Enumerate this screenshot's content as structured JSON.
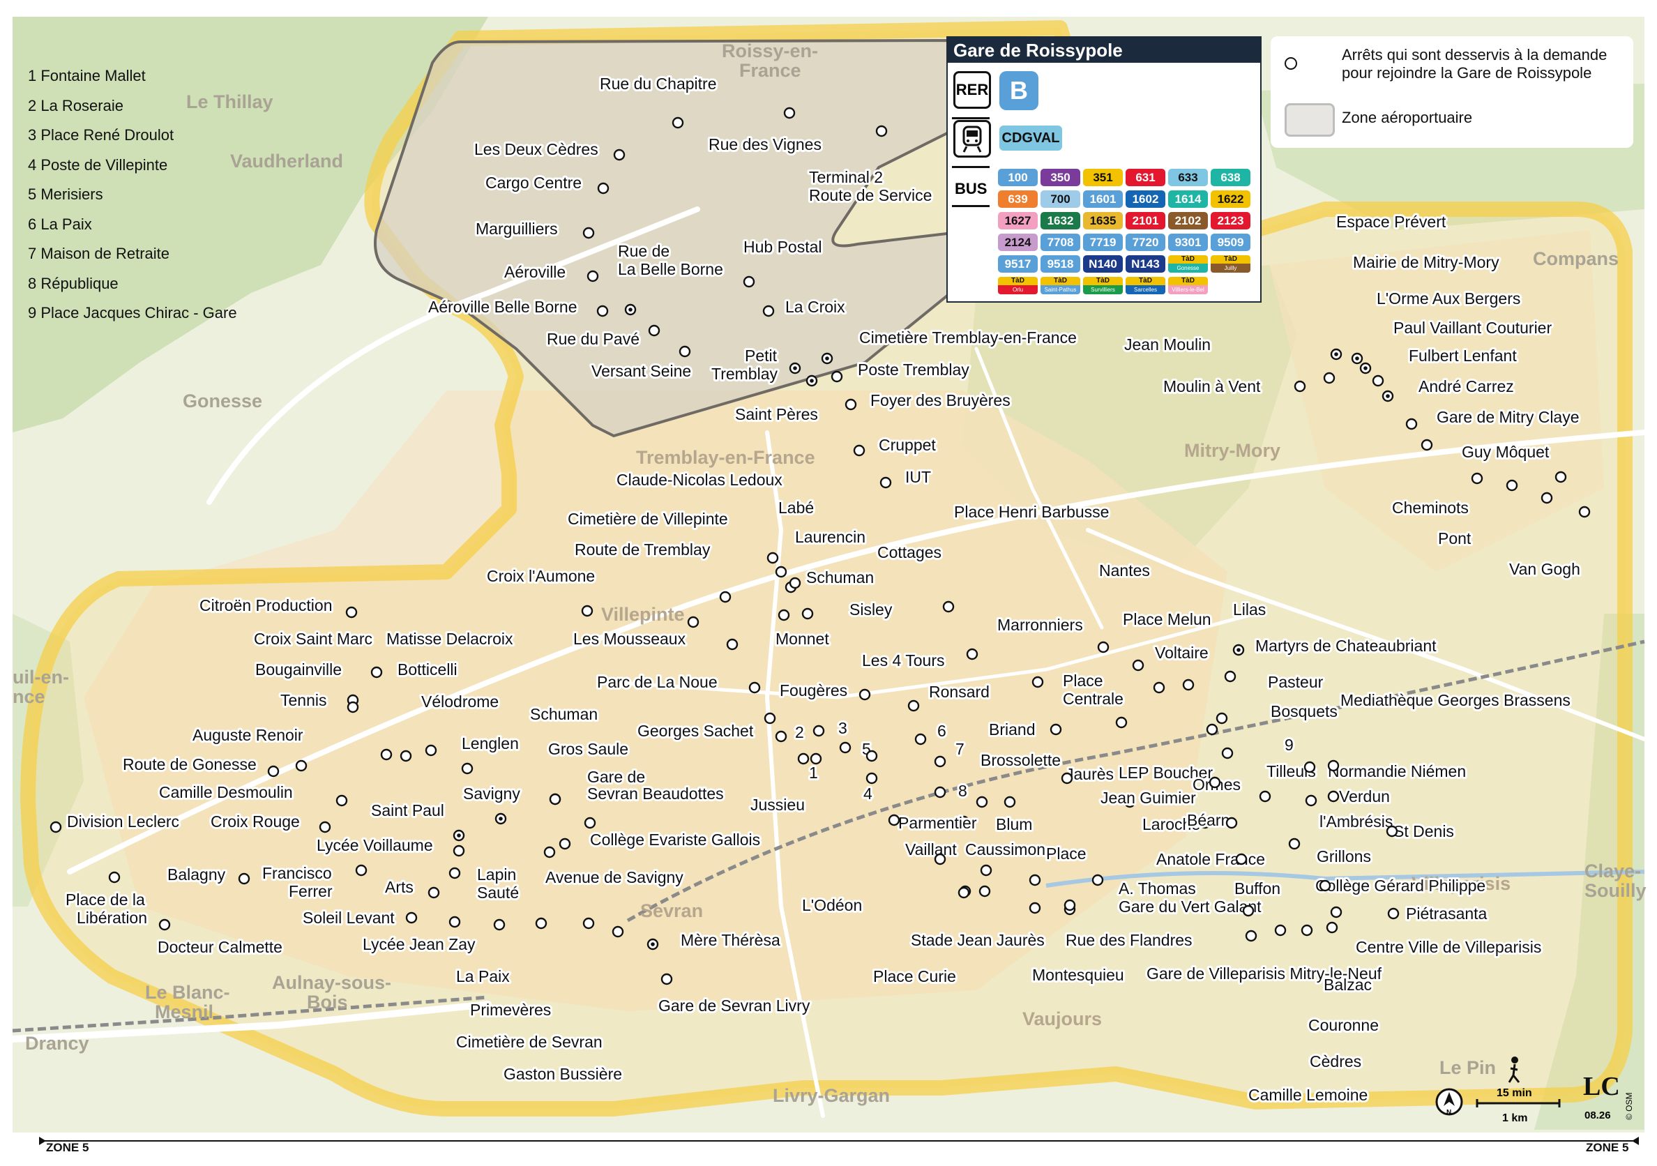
{
  "numbered_stops": [
    "1 Fontaine Mallet",
    "2 La Roseraie",
    "3 Place René Droulot",
    "4 Poste de Villepinte",
    "5 Merisiers",
    "6 La Paix",
    "7 Maison de Retraite",
    "8 République",
    "9 Place Jacques Chirac - Gare"
  ],
  "legend": {
    "on_demand_text": "Arrêts qui sont desservis à la demande\npour  rejoindre la Gare de Roissypole",
    "zone_text": "Zone aéroportuaire"
  },
  "gare": {
    "title": "Gare de Roissypole",
    "rer_label": "RER",
    "rer_line": "B",
    "cdgval_label": "CDGVAL",
    "bus_label": "BUS",
    "bus_lines": [
      {
        "n": "100",
        "c": "#5aa0d8"
      },
      {
        "n": "350",
        "c": "#7b3b9a"
      },
      {
        "n": "351",
        "c": "#f2c200",
        "t": "#111"
      },
      {
        "n": "631",
        "c": "#e3182e"
      },
      {
        "n": "633",
        "c": "#7fc6e2",
        "t": "#111"
      },
      {
        "n": "638",
        "c": "#1fb5a4"
      },
      {
        "n": "639",
        "c": "#ef7f2f"
      },
      {
        "n": "700",
        "c": "#9ecbe8",
        "t": "#111"
      },
      {
        "n": "1601",
        "c": "#5aa0d8"
      },
      {
        "n": "1602",
        "c": "#1565b5"
      },
      {
        "n": "1614",
        "c": "#1fb5a4"
      },
      {
        "n": "1622",
        "c": "#f2c200",
        "t": "#111"
      },
      {
        "n": "1627",
        "c": "#f29fc0",
        "t": "#111"
      },
      {
        "n": "1632",
        "c": "#1b7a4a"
      },
      {
        "n": "1635",
        "c": "#e8b830",
        "t": "#111"
      },
      {
        "n": "2101",
        "c": "#e3182e"
      },
      {
        "n": "2102",
        "c": "#8b5a2b"
      },
      {
        "n": "2123",
        "c": "#e3182e"
      },
      {
        "n": "2124",
        "c": "#c79ccc",
        "t": "#111"
      },
      {
        "n": "7708",
        "c": "#5aa0d8"
      },
      {
        "n": "7719",
        "c": "#5aa0d8"
      },
      {
        "n": "7720",
        "c": "#5aa0d8"
      },
      {
        "n": "9301",
        "c": "#5aa0d8"
      },
      {
        "n": "9509",
        "c": "#5aa0d8"
      },
      {
        "n": "9517",
        "c": "#5aa0d8"
      },
      {
        "n": "9518",
        "c": "#5aa0d8"
      },
      {
        "n": "N140",
        "c": "#1b3a8a"
      },
      {
        "n": "N143",
        "c": "#1b3a8a"
      }
    ],
    "tad_lines": [
      {
        "top": "TàD",
        "bot": "Gonesse",
        "c": "#1fb5a4"
      },
      {
        "top": "TàD",
        "bot": "Juilly",
        "c": "#8b5a2b"
      },
      {
        "top": "TàD",
        "bot": "Orlu",
        "c": "#e3182e"
      },
      {
        "top": "TàD",
        "bot": "Saint-Pathus",
        "c": "#5aa0d8"
      },
      {
        "top": "TàD",
        "bot": "Survilliers",
        "c": "#1b9a4a"
      },
      {
        "top": "TàD",
        "bot": "Sarcelles",
        "c": "#1565b5"
      },
      {
        "top": "TàD",
        "bot": "Villiers-le-Bel",
        "c": "#f29fc0"
      }
    ]
  },
  "zones": {
    "left": "ZONE 5",
    "right": "ZONE 5"
  },
  "scale": {
    "time": "15 min",
    "distance": "1 km",
    "credit": "08.26",
    "osm": "© OSM"
  },
  "towns": [
    {
      "t": "Roissy-en-",
      "t2": "France"
    },
    {
      "t": "Le Thillay"
    },
    {
      "t": "Vaudherland"
    },
    {
      "t": "Gonesse"
    },
    {
      "t": "Tremblay-en-France"
    },
    {
      "t": "Mitry-Mory"
    },
    {
      "t": "Compans"
    },
    {
      "t": "Villepinte"
    },
    {
      "t": "uil-en-",
      "t2": "nce"
    },
    {
      "t": "Sevran"
    },
    {
      "t": "Aulnay-sous-",
      "t2": "Bois"
    },
    {
      "t": "Le Blanc-",
      "t2": "Mesnil"
    },
    {
      "t": "Drancy"
    },
    {
      "t": "Vaujours"
    },
    {
      "t": "Livry-Gargan"
    },
    {
      "t": "Villeparisis"
    },
    {
      "t": "Claye-",
      "t2": "Souilly"
    },
    {
      "t": "Le Pin"
    }
  ],
  "stops": [
    "Rue du Chapitre",
    "Rue des Vignes",
    "Les Deux Cèdres",
    "Cargo Centre",
    "Terminal 2",
    "Route de Service",
    "Marguilliers",
    "Rue de",
    "La Belle Borne",
    "Hub Postal",
    "Aéroville",
    "Aéroville Belle Borne",
    "La Croix",
    "Rue du Pavé",
    "Versant Seine",
    "Cimetière Tremblay-en-France",
    "Petit",
    "Tremblay",
    "Poste Tremblay",
    "Foyer des Bruyères",
    "Saint Pères",
    "Cruppet",
    "IUT",
    "Claude-Nicolas Ledoux",
    "Labé",
    "Cimetière de Villepinte",
    "Laurencin",
    "Route de Tremblay",
    "Schuman",
    "Croix l'Aumone",
    "Sisley",
    "Citroën Production",
    "Les Mousseaux",
    "Monnet",
    "Croix Saint Marc",
    "Matisse Delacroix",
    "Bougainville",
    "Botticelli",
    "Tennis",
    "Vélodrome",
    "Auguste Renoir",
    "Lenglen",
    "Schuman",
    "Route de Gonesse",
    "Gros Saule",
    "Camille Desmoulin",
    "Gare de",
    "Sevran Beaudottes",
    "Savigny",
    "Division Leclerc",
    "Croix Rouge",
    "Saint Paul",
    "Lycée Voillaume",
    "Collège Evariste Gallois",
    "Balagny",
    "Francisco",
    "Ferrer",
    "Lapin",
    "Sauté",
    "Avenue de Savigny",
    "Arts",
    "Place de la",
    "Libération",
    "Soleil Levant",
    "Docteur Calmette",
    "Lycée Jean Zay",
    "Mère Thérèsa",
    "La Paix",
    "Primevères",
    "Gare de Sevran Livry",
    "Cimetière de Sevran",
    "Gaston Bussière",
    "Parc de La Noue",
    "Fougères",
    "Georges Sachet",
    "2",
    "3",
    "1",
    "Jussieu",
    "5",
    "4",
    "Les 4 Tours",
    "Ronsard",
    "6",
    "7",
    "8",
    "Cottages",
    "Place Henri Barbusse",
    "Marronniers",
    "Nantes",
    "Place Melun",
    "Lilas",
    "Voltaire",
    "Martyrs de Chateaubriant",
    "Place",
    "Centrale",
    "Pasteur",
    "Bosquets",
    "Mediathèque Georges Brassens",
    "Briand",
    "Brossolette",
    "Jaurès",
    "LEP Boucher",
    "Jean Guimier",
    "Blum",
    "Parmentier",
    "Vaillant",
    "Caussimon",
    "Place",
    "A. Thomas",
    "Gare du Vert Galant",
    "L'Odéon",
    "Stade Jean Jaurès",
    "Rue des Flandres",
    "Place Curie",
    "Montesquieu",
    "Gare de Villeparisis Mitry-le-Neuf",
    "9",
    "Ormes",
    "Tilleuls",
    "Normandie Niémen",
    "Verdun",
    "Laroche",
    "Béarn",
    "l'Ambrésis",
    "St Denis",
    "Anatole France",
    "Grillons",
    "Buffon",
    "Collège Gérard Philippe",
    "Piétrasanta",
    "Centre Ville de Villeparisis",
    "Balzac",
    "Couronne",
    "Cèdres",
    "Camille Lemoine",
    "Espace Prévert",
    "Mairie de Mitry-Mory",
    "L'Orme Aux Bergers",
    "Paul Vaillant Couturier",
    "Jean Moulin",
    "Fulbert Lenfant",
    "Moulin à Vent",
    "André Carrez",
    "Gare de Mitry Claye",
    "Guy Môquet",
    "Cheminots",
    "Pont",
    "Van Gogh"
  ]
}
